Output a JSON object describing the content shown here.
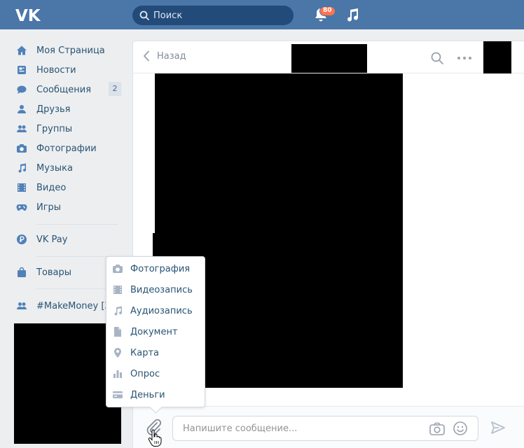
{
  "header": {
    "logo": "vk-logo",
    "search_placeholder": "Поиск",
    "notifications_count": "80",
    "accent_color": "#4a76a8"
  },
  "sidebar": {
    "items": [
      {
        "label": "Моя Страница",
        "icon": "home-icon"
      },
      {
        "label": "Новости",
        "icon": "news-icon"
      },
      {
        "label": "Сообщения",
        "icon": "messages-icon",
        "count": "2"
      },
      {
        "label": "Друзья",
        "icon": "friend-icon"
      },
      {
        "label": "Группы",
        "icon": "groups-icon"
      },
      {
        "label": "Фотографии",
        "icon": "camera-icon"
      },
      {
        "label": "Музыка",
        "icon": "music-icon"
      },
      {
        "label": "Видео",
        "icon": "video-icon"
      },
      {
        "label": "Игры",
        "icon": "gamepad-icon"
      },
      {
        "label": "VK Pay",
        "icon": "vkpay-icon"
      },
      {
        "label": "Товары",
        "icon": "bag-icon"
      },
      {
        "label": "#MakeMoney [Зар",
        "icon": "groups-icon"
      }
    ]
  },
  "chat": {
    "back_label": "Назад",
    "input_placeholder": "Напишите сообщение..."
  },
  "attach_menu": {
    "items": [
      {
        "label": "Фотография",
        "icon": "camera-icon"
      },
      {
        "label": "Видеозапись",
        "icon": "film-icon"
      },
      {
        "label": "Аудиозапись",
        "icon": "music-icon"
      },
      {
        "label": "Документ",
        "icon": "document-icon"
      },
      {
        "label": "Карта",
        "icon": "map-pin-icon"
      },
      {
        "label": "Опрос",
        "icon": "poll-icon"
      },
      {
        "label": "Деньги",
        "icon": "money-card-icon"
      }
    ]
  }
}
